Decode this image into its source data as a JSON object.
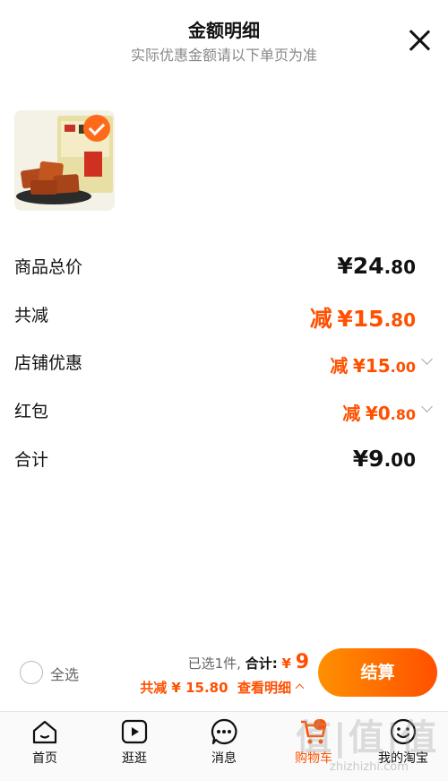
{
  "header": {
    "title": "金额明细",
    "subtitle": "实际优惠金额请以下单页为准"
  },
  "product": {
    "image_icon": "braised-tofu-product-image",
    "selected": true
  },
  "rows": [
    {
      "label": "商品总价",
      "prefix": "",
      "yen": "¥",
      "int": "24",
      "dec": ".80",
      "color": "#111111"
    },
    {
      "label": "共减",
      "prefix": "减",
      "yen": "¥",
      "int": "15",
      "dec": ".80",
      "color": "#ff5000"
    },
    {
      "label": "店铺优惠",
      "prefix": "减",
      "yen": "¥",
      "int": "15",
      "dec": ".00",
      "color": "#ff5000"
    },
    {
      "label": "红包",
      "prefix": "减",
      "yen": "¥",
      "int": "0",
      "dec": ".80",
      "color": "#ff5000"
    },
    {
      "label": "合计",
      "prefix": "",
      "yen": "¥",
      "int": "9",
      "dec": ".00",
      "color": "#111111"
    }
  ],
  "bottom_bar": {
    "select_all": "全选",
    "selected_count": "已选1件,",
    "total_label": "合计:",
    "total_yen": "¥",
    "total_value": "9",
    "discount_text": "共减 ¥ 15.80",
    "detail_link": "查看明细",
    "checkout": "结算"
  },
  "tabbar": [
    {
      "label": "首页",
      "icon": "home-icon"
    },
    {
      "label": "逛逛",
      "icon": "play-icon"
    },
    {
      "label": "消息",
      "icon": "message-icon"
    },
    {
      "label": "购物车",
      "icon": "cart-icon",
      "active": true
    },
    {
      "label": "我的淘宝",
      "icon": "profile-icon"
    }
  ],
  "watermark": {
    "text": "值|值|值",
    "url": "zhizhizhi.com"
  },
  "colors": {
    "accent": "#ff5000",
    "accent_gradient_start": "#ff9000"
  }
}
